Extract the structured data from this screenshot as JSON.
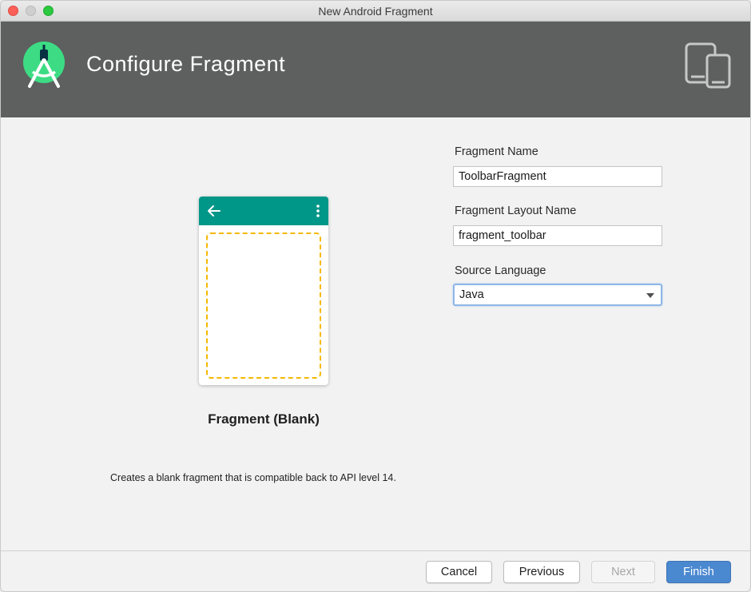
{
  "window": {
    "title": "New Android Fragment"
  },
  "header": {
    "title": "Configure Fragment",
    "logo_icon": "android-studio-logo",
    "devices_icon": "phone-tablet-icon",
    "background": "#5d605f"
  },
  "preview": {
    "toolbar_color": "#009688",
    "fragment_border_color": "#f5b800",
    "back_icon": "arrow-left-icon",
    "menu_icon": "overflow-menu-icon",
    "caption": "Fragment (Blank)",
    "description": "Creates a blank fragment that is compatible back to API level 14."
  },
  "form": {
    "fragment_name": {
      "label": "Fragment Name",
      "value": "ToolbarFragment"
    },
    "layout_name": {
      "label": "Fragment Layout Name",
      "value": "fragment_toolbar"
    },
    "source_language": {
      "label": "Source Language",
      "value": "Java"
    }
  },
  "footer": {
    "cancel": "Cancel",
    "previous": "Previous",
    "next": "Next",
    "finish": "Finish",
    "accent": "#4a88d0"
  }
}
